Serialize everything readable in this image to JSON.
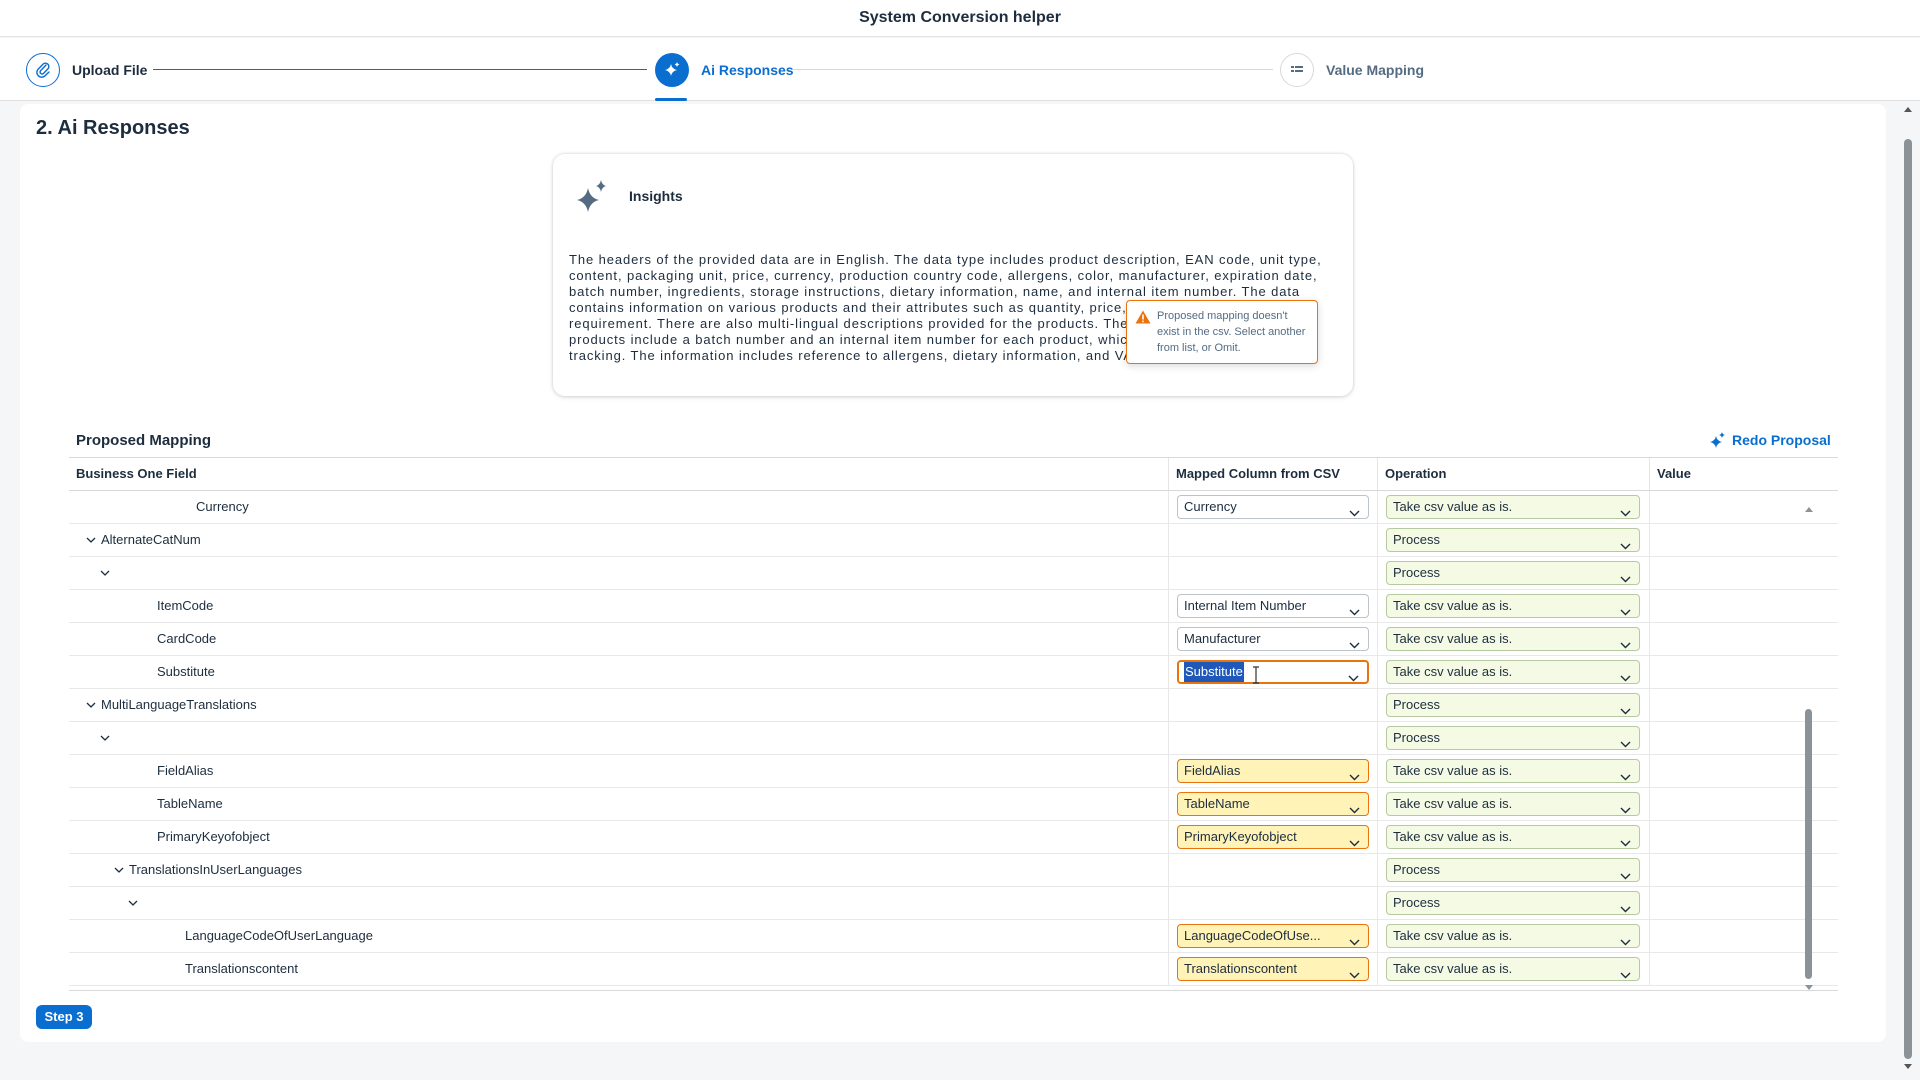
{
  "app": {
    "title": "System Conversion helper"
  },
  "wizard": {
    "steps": [
      {
        "label": "Upload File",
        "icon": "paperclip-icon",
        "state": "completed"
      },
      {
        "label": "Ai Responses",
        "icon": "sparkle-icon",
        "state": "active"
      },
      {
        "label": "Value Mapping",
        "icon": "grid-icon",
        "state": "pending"
      }
    ]
  },
  "section": {
    "title": "2. Ai Responses"
  },
  "insights": {
    "heading": "Insights",
    "text": "The headers of the provided data are in English. The data type includes product description, EAN code, unit type, content, packaging unit, price, currency, production country code, allergens, color, manufacturer, expiration date, batch number, ingredients, storage instructions, dietary information, name, and internal item number. The data contains information on various products and their attributes such as quantity, price, expiry date and storage requirement. There are also multi-lingual descriptions provided for the products. The identifying numbers of the products include a batch number and an internal item number for each product, which may help in inventory tracking. The information includes reference to allergens, dietary information, and VAT information."
  },
  "mapping": {
    "title": "Proposed Mapping",
    "redo_label": "Redo Proposal",
    "columns": [
      "Business One Field",
      "Mapped Column from CSV",
      "Operation",
      "Value"
    ],
    "rows": [
      {
        "field": "Currency",
        "expandable": false,
        "mapped": "Currency",
        "mapped_style": "normal",
        "operation": "Take csv value as is.",
        "value": ""
      },
      {
        "field": "AlternateCatNum",
        "expandable": true,
        "mapped": "",
        "mapped_style": "none",
        "operation": "Process",
        "value": ""
      },
      {
        "field": "",
        "expandable": true,
        "mapped": "",
        "mapped_style": "none",
        "operation": "Process",
        "value": ""
      },
      {
        "field": "ItemCode",
        "expandable": false,
        "mapped": "Internal Item Number",
        "mapped_style": "normal",
        "operation": "Take csv value as is.",
        "value": ""
      },
      {
        "field": "CardCode",
        "expandable": false,
        "mapped": "Manufacturer",
        "mapped_style": "normal",
        "operation": "Take csv value as is.",
        "value": ""
      },
      {
        "field": "Substitute",
        "expandable": false,
        "mapped": "Substitute",
        "mapped_style": "error",
        "operation": "Take csv value as is.",
        "value": ""
      },
      {
        "field": "MultiLanguageTranslations",
        "expandable": true,
        "mapped": "",
        "mapped_style": "none",
        "operation": "Process",
        "value": ""
      },
      {
        "field": "",
        "expandable": true,
        "mapped": "",
        "mapped_style": "none",
        "operation": "Process",
        "value": ""
      },
      {
        "field": "FieldAlias",
        "expandable": false,
        "mapped": "FieldAlias",
        "mapped_style": "warning",
        "operation": "Take csv value as is.",
        "value": ""
      },
      {
        "field": "TableName",
        "expandable": false,
        "mapped": "TableName",
        "mapped_style": "warning",
        "operation": "Take csv value as is.",
        "value": ""
      },
      {
        "field": "PrimaryKeyofobject",
        "expandable": false,
        "mapped": "PrimaryKeyofobject",
        "mapped_style": "warning",
        "operation": "Take csv value as is.",
        "value": ""
      },
      {
        "field": "TranslationsInUserLanguages",
        "expandable": true,
        "mapped": "",
        "mapped_style": "none",
        "operation": "Process",
        "value": ""
      },
      {
        "field": "",
        "expandable": true,
        "mapped": "",
        "mapped_style": "none",
        "operation": "Process",
        "value": ""
      },
      {
        "field": "LanguageCodeOfUserLanguage",
        "expandable": false,
        "mapped": "LanguageCodeOfUse...",
        "mapped_style": "warning",
        "operation": "Take csv value as is.",
        "value": ""
      },
      {
        "field": "Translationscontent",
        "expandable": false,
        "mapped": "Translationscontent",
        "mapped_style": "warning",
        "operation": "Take csv value as is.",
        "value": ""
      }
    ],
    "error_popover": "Proposed mapping doesn't exist in the csv. Select another from list, or Omit."
  },
  "footer": {
    "next_label": "Step 3"
  },
  "colors": {
    "accent": "#0a6ed1",
    "warning": "#e9730c",
    "warning_bg": "#fff3b8",
    "operation_bg": "#f5fae5"
  }
}
